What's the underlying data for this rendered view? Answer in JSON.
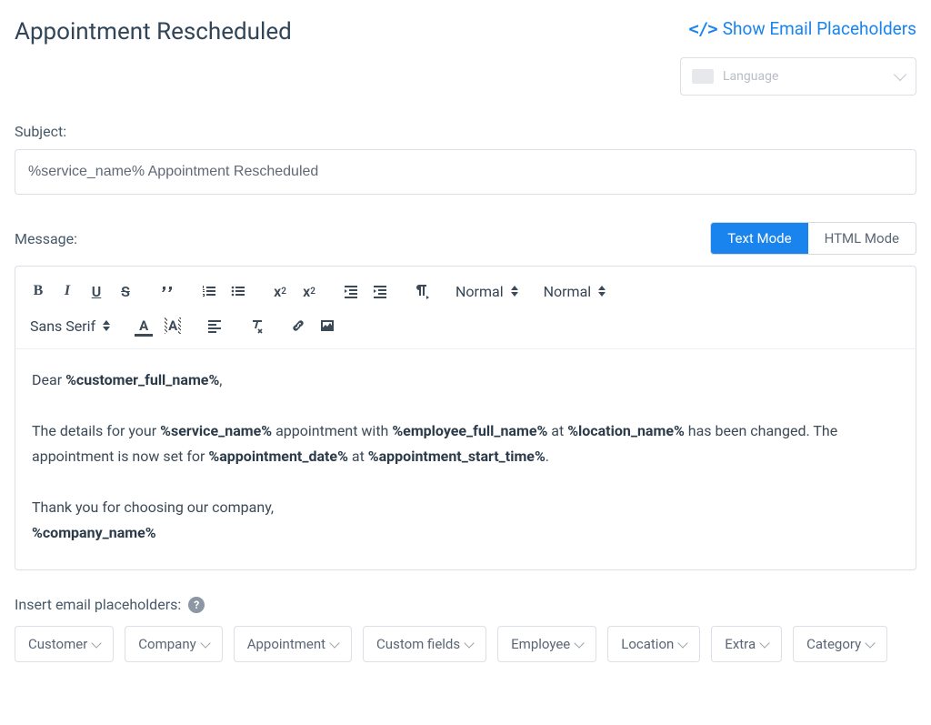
{
  "header": {
    "title": "Appointment Rescheduled",
    "show_placeholders": "Show Email Placeholders",
    "language_placeholder": "Language"
  },
  "subject": {
    "label": "Subject:",
    "value": "%service_name% Appointment Rescheduled"
  },
  "message": {
    "label": "Message:",
    "mode_text": "Text Mode",
    "mode_html": "HTML Mode",
    "active_mode": "text"
  },
  "toolbar": {
    "size_label": "Normal",
    "header_label": "Normal",
    "font_label": "Sans Serif"
  },
  "body": {
    "greeting_prefix": "Dear ",
    "greeting_ph": "%customer_full_name%",
    "greeting_suffix": ",",
    "p1a": "The details for your ",
    "p1_service": "%service_name%",
    "p1b": " appointment with ",
    "p1_employee": "%employee_full_name%",
    "p1c": " at ",
    "p1_location": "%location_name%",
    "p1d": " has been changed. The appointment is now set for ",
    "p1_date": "%appointment_date%",
    "p1e": " at ",
    "p1_time": "%appointment_start_time%",
    "p1f": ".",
    "thanks": " Thank you for choosing our company,",
    "company": "%company_name%"
  },
  "insert_label": "Insert email placeholders:",
  "placeholder_buttons": [
    "Customer",
    "Company",
    "Appointment",
    "Custom fields",
    "Employee",
    "Location",
    "Extra",
    "Category"
  ]
}
